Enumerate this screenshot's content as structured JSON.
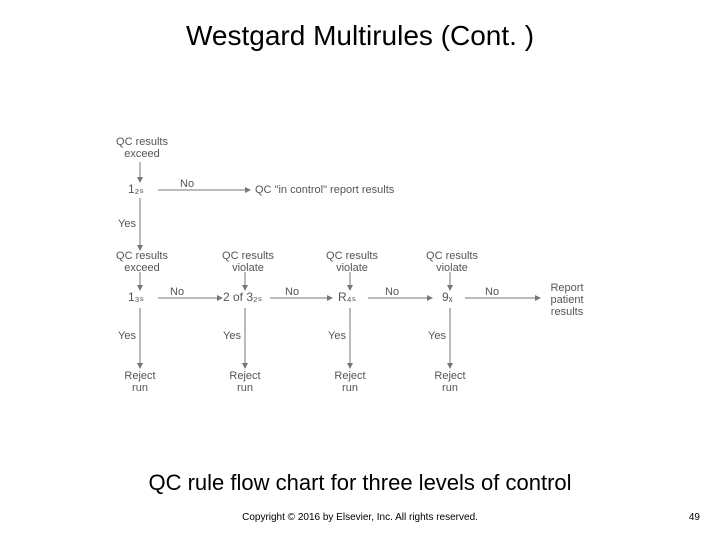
{
  "title": "Westgard Multirules (Cont. )",
  "caption": "QC rule flow chart for three levels of control",
  "copyright": "Copyright © 2016 by Elsevier, Inc. All rights reserved.",
  "page_number": "49",
  "diagram": {
    "headers": {
      "top_exceed": "QC results\nexceed",
      "in_control": "QC \"in control\" report results",
      "exceed": "QC results\nexceed",
      "violate": "QC results\nviolate",
      "report": "Report\npatient\nresults"
    },
    "rules": {
      "r1_2s": "1₂ₛ",
      "r1_3s": "1₃ₛ",
      "r2_of_3_2s": "2 of 3₂ₛ",
      "rR_4s": "R₄ₛ",
      "r9_x": "9ₓ"
    },
    "edges": {
      "no": "No",
      "yes": "Yes"
    },
    "outcomes": {
      "reject": "Reject\nrun"
    }
  }
}
